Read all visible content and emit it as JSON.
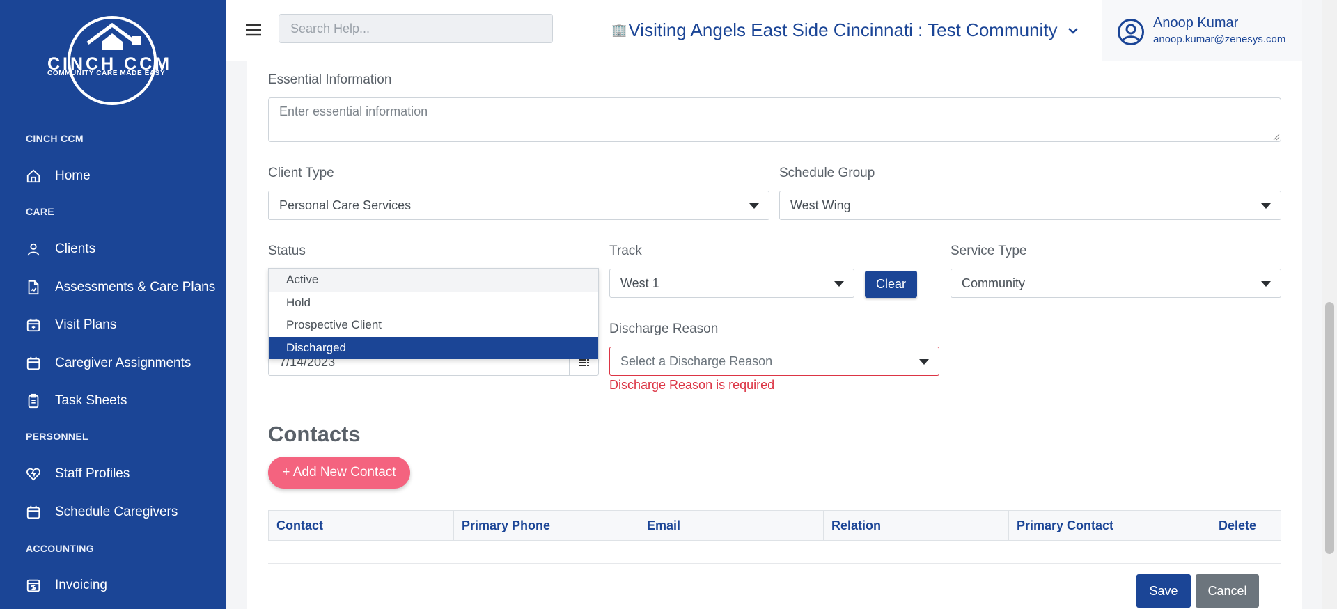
{
  "sidebar": {
    "logo": {
      "line1": "CINCH CCM",
      "line2": "COMMUNITY CARE MADE EASY"
    },
    "sections": [
      {
        "title": "CINCH CCM",
        "items": [
          {
            "label": "Home",
            "icon": "home-icon"
          }
        ]
      },
      {
        "title": "CARE",
        "items": [
          {
            "label": "Clients",
            "icon": "person-icon"
          },
          {
            "label": "Assessments & Care Plans",
            "icon": "document-icon"
          },
          {
            "label": "Visit Plans",
            "icon": "calendar-plus-icon"
          },
          {
            "label": "Caregiver Assignments",
            "icon": "calendar-icon"
          },
          {
            "label": "Task Sheets",
            "icon": "clipboard-icon"
          }
        ]
      },
      {
        "title": "PERSONNEL",
        "items": [
          {
            "label": "Staff Profiles",
            "icon": "heart-icon"
          },
          {
            "label": "Schedule Caregivers",
            "icon": "calendar-icon"
          }
        ]
      },
      {
        "title": "ACCOUNTING",
        "items": [
          {
            "label": "Invoicing",
            "icon": "invoice-icon"
          }
        ]
      }
    ]
  },
  "topbar": {
    "search_placeholder": "Search Help...",
    "community": "Visiting Angels East Side Cincinnati : Test Community",
    "user": {
      "name": "Anoop Kumar",
      "email": "anoop.kumar@zenesys.com"
    }
  },
  "form": {
    "essential_info": {
      "label": "Essential Information",
      "placeholder": "Enter essential information"
    },
    "client_type": {
      "label": "Client Type",
      "value": "Personal Care Services"
    },
    "schedule_group": {
      "label": "Schedule Group",
      "value": "West Wing"
    },
    "status": {
      "label": "Status",
      "options": [
        "Active",
        "Hold",
        "Prospective Client",
        "Discharged"
      ],
      "hovered": "Active",
      "selected": "Discharged"
    },
    "date_value": "7/14/2023",
    "track": {
      "label": "Track",
      "value": "West 1",
      "clear_label": "Clear"
    },
    "service_type": {
      "label": "Service Type",
      "value": "Community"
    },
    "discharge_reason": {
      "label": "Discharge Reason",
      "placeholder": "Select a Discharge Reason",
      "error": "Discharge Reason is required"
    }
  },
  "contacts": {
    "title": "Contacts",
    "add_label": "+  Add New Contact",
    "columns": [
      "Contact",
      "Primary Phone",
      "Email",
      "Relation",
      "Primary Contact",
      "Delete"
    ]
  },
  "actions": {
    "save": "Save",
    "cancel": "Cancel"
  },
  "colors": {
    "primary": "#1b4596",
    "accent": "#f4637f",
    "error": "#dc3545",
    "secondary": "#6c757d"
  }
}
